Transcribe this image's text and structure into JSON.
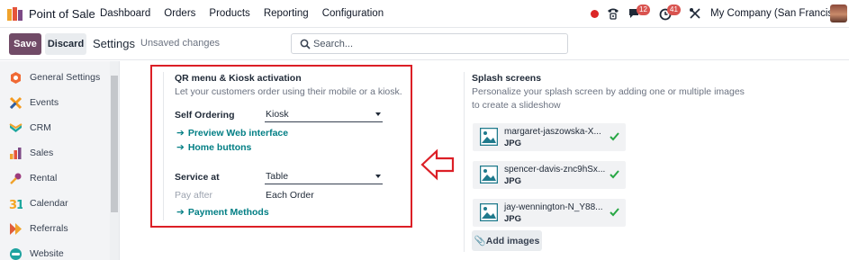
{
  "navbar": {
    "app_name": "Point of Sale",
    "menu": [
      "Dashboard",
      "Orders",
      "Products",
      "Reporting",
      "Configuration"
    ],
    "chat_badge": "12",
    "activity_badge": "41",
    "company": "My Company (San Francisco)"
  },
  "control": {
    "save_label": "Save",
    "discard_label": "Discard",
    "title": "Settings",
    "status": "Unsaved changes",
    "search_placeholder": "Search..."
  },
  "sidebar": {
    "items": [
      {
        "label": "General Settings",
        "icon": "general-settings-icon",
        "color": "#f06a35"
      },
      {
        "label": "Events",
        "icon": "events-icon",
        "color": "#f49a1e"
      },
      {
        "label": "CRM",
        "icon": "crm-icon",
        "color": "#1ea79e"
      },
      {
        "label": "Sales",
        "icon": "sales-icon",
        "color": "#e5543b"
      },
      {
        "label": "Rental",
        "icon": "rental-icon",
        "color": "#9c3c7d"
      },
      {
        "label": "Calendar",
        "icon": "calendar-icon",
        "color": "#f5a623"
      },
      {
        "label": "Referrals",
        "icon": "referrals-icon",
        "color": "#e05d3a"
      },
      {
        "label": "Website",
        "icon": "website-icon",
        "color": "#1fa3a0"
      }
    ]
  },
  "qr": {
    "title": "QR menu & Kiosk activation",
    "description": "Let your customers order using their mobile or a kiosk.",
    "self_ordering_label": "Self Ordering",
    "self_ordering_value": "Kiosk",
    "preview_link": "Preview Web interface",
    "home_buttons_link": "Home buttons",
    "service_at_label": "Service at",
    "service_at_value": "Table",
    "pay_after_label": "Pay after",
    "pay_after_value": "Each Order",
    "payment_methods_link": "Payment Methods"
  },
  "splash": {
    "title": "Splash screens",
    "description_line1": "Personalize your splash screen by adding one or multiple images",
    "description_line2": "to create a slideshow",
    "images": [
      {
        "name": "margaret-jaszowska-X...",
        "type": "JPG"
      },
      {
        "name": "spencer-davis-znc9hSx...",
        "type": "JPG"
      },
      {
        "name": "jay-wennington-N_Y88...",
        "type": "JPG"
      }
    ],
    "add_label": "Add images"
  },
  "colors": {
    "brand": "#714b67",
    "link": "#017e84",
    "highlight": "#dc1f26"
  }
}
